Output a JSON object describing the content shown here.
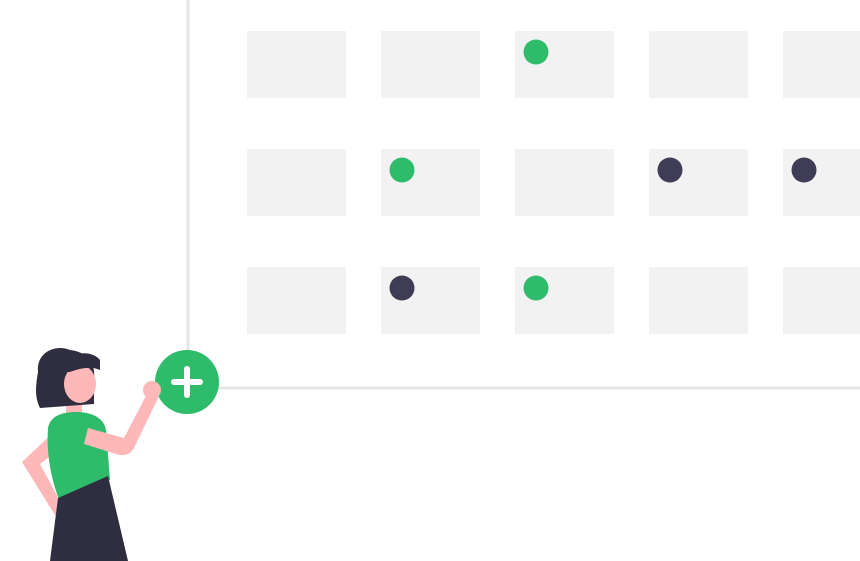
{
  "colors": {
    "background": "#ffffff",
    "frame_line": "#e6e6e6",
    "cell": "#f2f2f2",
    "dot_green": "#2ebc6b",
    "dot_dark": "#3f3d56",
    "add_button": "#2ebc6b",
    "add_icon": "#ffffff",
    "skin": "#ffb8b8",
    "hair": "#2f2e41",
    "shirt": "#2ebc6b",
    "skirt": "#2f2e41"
  },
  "icons": {
    "add_button": "plus-icon"
  },
  "calendar": {
    "rows": [
      [
        "none",
        "none",
        "green",
        "none",
        "none"
      ],
      [
        "none",
        "green",
        "none",
        "dark",
        "dark"
      ],
      [
        "none",
        "dark",
        "green",
        "none",
        "none"
      ]
    ]
  }
}
